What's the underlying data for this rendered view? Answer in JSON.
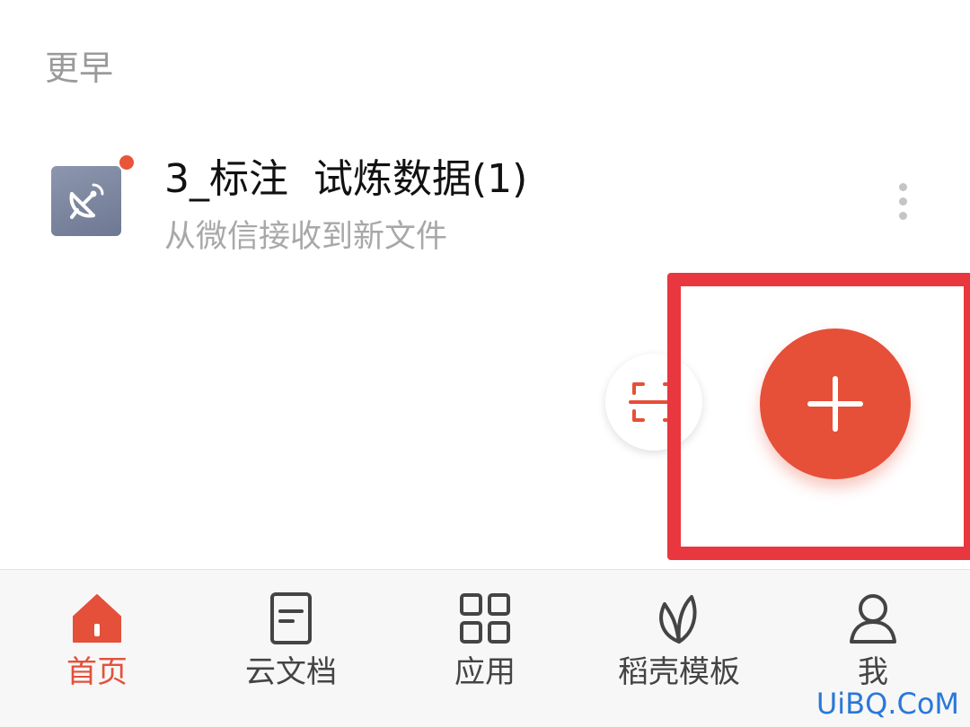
{
  "list": {
    "section_header": "更早",
    "files": [
      {
        "name": "3_标注  试炼数据(1)",
        "subtitle": "从微信接收到新文件",
        "icon": "satellite-dish-icon",
        "unread": true
      }
    ]
  },
  "fab": {
    "scan_icon": "scan-icon",
    "add_icon": "plus-icon"
  },
  "tab_bar": {
    "items": [
      {
        "label": "首页",
        "icon": "home-icon",
        "active": true
      },
      {
        "label": "云文档",
        "icon": "document-icon",
        "active": false
      },
      {
        "label": "应用",
        "icon": "apps-grid-icon",
        "active": false
      },
      {
        "label": "稻壳模板",
        "icon": "leaf-icon",
        "active": false
      },
      {
        "label": "我",
        "icon": "user-icon",
        "active": false
      }
    ]
  },
  "watermark": "UiBQ.CoM",
  "colors": {
    "accent": "#e64f38",
    "highlight_box": "#e8373f",
    "tab_active": "#e4503a",
    "tab_inactive": "#444444"
  }
}
